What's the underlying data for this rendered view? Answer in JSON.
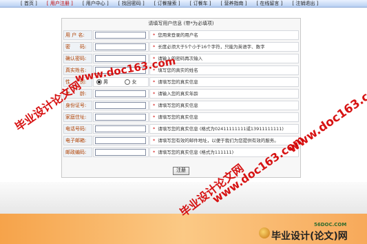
{
  "nav": {
    "items": [
      {
        "label": "[ 首页 ]",
        "active": false
      },
      {
        "label": "[ 用户注册 ]",
        "active": true
      },
      {
        "label": "[ 用户中心 ]",
        "active": false
      },
      {
        "label": "[ 找回密码 ]",
        "active": false
      },
      {
        "label": "[ 订餐搜索 ]",
        "active": false
      },
      {
        "label": "[ 订餐车 ]",
        "active": false
      },
      {
        "label": "[ 营养指南 ]",
        "active": false
      },
      {
        "label": "[ 在线留言 ]",
        "active": false
      },
      {
        "label": "[ 注销退出 ]",
        "active": false
      }
    ]
  },
  "form": {
    "title": "请填写用户信息 (带*为必填项)",
    "rows": [
      {
        "label": "用 户 名:",
        "hint": "您用来登录的用户名"
      },
      {
        "label": "密　　码:",
        "hint": "长度必须大于5个小于16个字符，只能为英语字、数字"
      },
      {
        "label": "确认密码:",
        "hint": "请输入的密码再次输入"
      },
      {
        "label": "真实姓名:",
        "hint": "填写您的真实的姓名"
      },
      {
        "label": "性　　别:",
        "hint": "请填写您的真实信息",
        "male": "男",
        "female": "女"
      },
      {
        "label": "年　　龄:",
        "hint": "请输入您的真实年龄"
      },
      {
        "label": "身份证号:",
        "hint": "请填写您的真实信息"
      },
      {
        "label": "家庭住址:",
        "hint": "请填写您的真实信息"
      },
      {
        "label": "电话号码:",
        "hint": "请填写您的真实信息 (格式为02411111111或13911111111)"
      },
      {
        "label": "电子邮箱:",
        "hint": "请填写您有效的邮件地址，以便于我们为您提供有效的服务。"
      },
      {
        "label": "邮政编码:",
        "hint": "请填写您的真实信息 (格式为111111)"
      }
    ],
    "submit_label": "注册"
  },
  "watermarks": {
    "wm1": "www.doc163.com",
    "wm2": "毕业设计论文网",
    "wm3": "www.doc163.com",
    "wm4": "毕业设计论文网",
    "wm5": "www.doc163.com"
  },
  "logo": {
    "site": "56DOC.COM",
    "text": "毕业设计(论文)网"
  },
  "colors": {
    "nav_bg": "#b9d0f2",
    "label_text": "#b04000",
    "required_star": "#d00000",
    "watermark": "#d40000",
    "footer_orange": "#f6a34a"
  }
}
